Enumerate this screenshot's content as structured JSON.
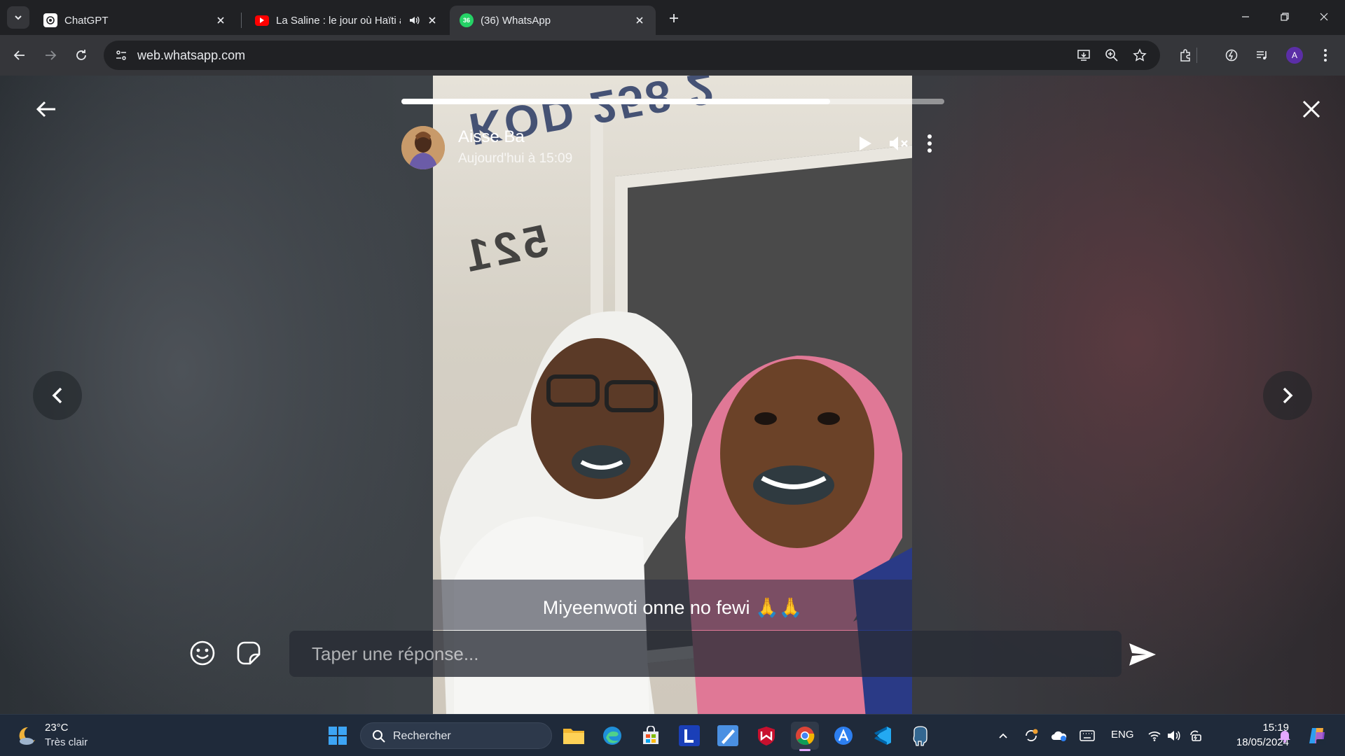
{
  "browser": {
    "tabs": [
      {
        "title": "ChatGPT",
        "active": false
      },
      {
        "title": "La Saline : le jour où Haïti a",
        "active": false,
        "audio": true
      },
      {
        "title": "(36) WhatsApp",
        "active": true,
        "badge": "36"
      }
    ],
    "url": "web.whatsapp.com",
    "profile_initial": "A",
    "accent": "#5b2ea6"
  },
  "status": {
    "contact_name": "Aisse Ba",
    "timestamp": "Aujourd'hui à 15:09",
    "progress": 0.79,
    "caption": "Miyeenwoti onne no fewi 🙏🙏",
    "reply_placeholder": "Taper une réponse..."
  },
  "taskbar": {
    "weather_temp": "23°C",
    "weather_desc": "Très clair",
    "search_label": "Rechercher",
    "language": "ENG",
    "time": "15:19",
    "date": "18/05/2024"
  }
}
